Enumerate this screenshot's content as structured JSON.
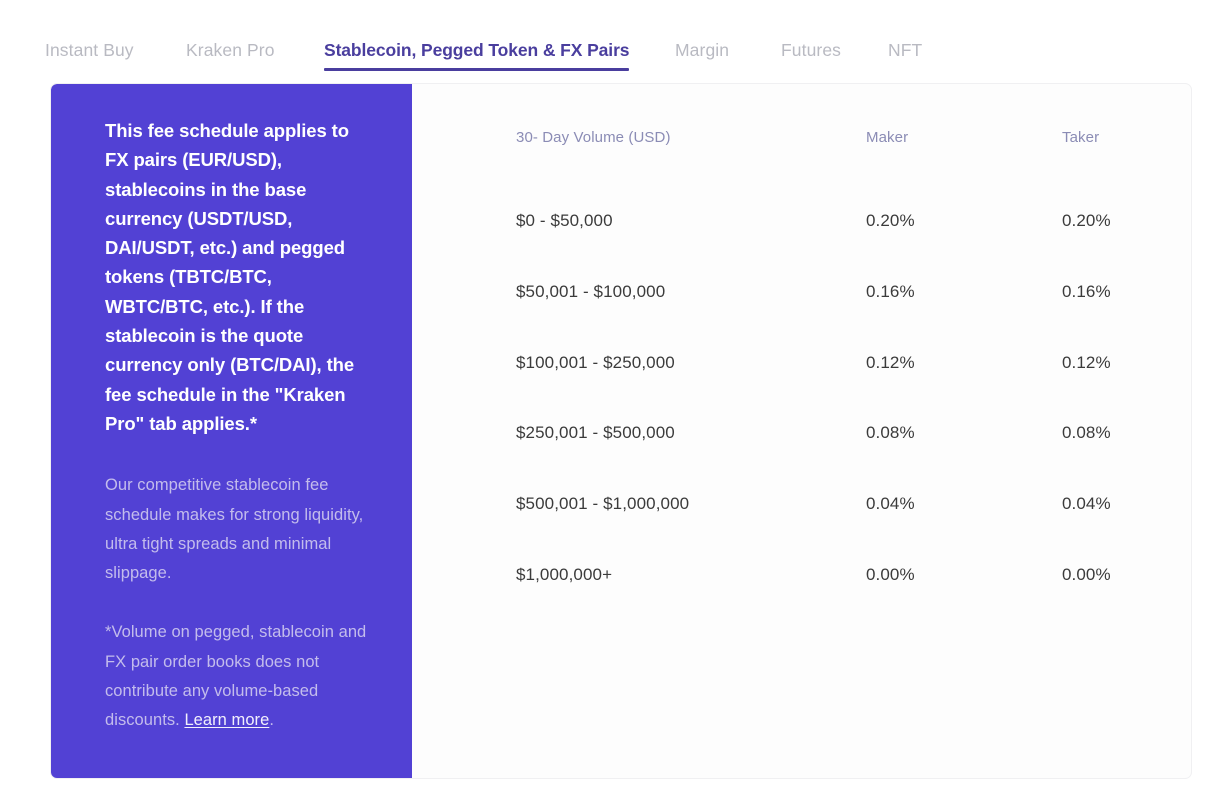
{
  "tabs": [
    {
      "label": "Instant Buy",
      "active": false
    },
    {
      "label": "Kraken Pro",
      "active": false
    },
    {
      "label": "Stablecoin, Pegged Token & FX Pairs",
      "active": true
    },
    {
      "label": "Margin",
      "active": false
    },
    {
      "label": "Futures",
      "active": false
    },
    {
      "label": "NFT",
      "active": false
    }
  ],
  "panel": {
    "heading": "This fee schedule applies to FX pairs (EUR/USD), stablecoins in the base currency (USDT/USD, DAI/USDT, etc.) and pegged tokens (TBTC/BTC, WBTC/BTC, etc.). If the stablecoin is the quote currency only (BTC/DAI), the fee schedule in the \"Kraken Pro\" tab applies.*",
    "body": "Our competitive stablecoin fee schedule makes for strong liquidity, ultra tight spreads and minimal slippage.",
    "note_prefix": "*Volume on pegged, stablecoin and FX pair order books does not contribute any volume-based discounts. ",
    "note_link": "Learn more",
    "note_suffix": "."
  },
  "table": {
    "headers": {
      "volume": "30- Day Volume (USD)",
      "maker": "Maker",
      "taker": "Taker"
    },
    "rows": [
      {
        "volume": "$0 - $50,000",
        "maker": "0.20%",
        "taker": "0.20%"
      },
      {
        "volume": "$50,001 - $100,000",
        "maker": "0.16%",
        "taker": "0.16%"
      },
      {
        "volume": "$100,001 - $250,000",
        "maker": "0.12%",
        "taker": "0.12%"
      },
      {
        "volume": "$250,001 - $500,000",
        "maker": "0.08%",
        "taker": "0.08%"
      },
      {
        "volume": "$500,001 - $1,000,000",
        "maker": "0.04%",
        "taker": "0.04%"
      },
      {
        "volume": "$1,000,000+",
        "maker": "0.00%",
        "taker": "0.00%"
      }
    ]
  },
  "colors": {
    "brand_purple": "#5241d4",
    "active_tab": "#4a3e9e",
    "inactive_tab": "#b9bac2",
    "panel_muted_text": "#c3bcec",
    "table_header_text": "#8b8cb5",
    "table_cell_text": "#3b3b3b"
  }
}
